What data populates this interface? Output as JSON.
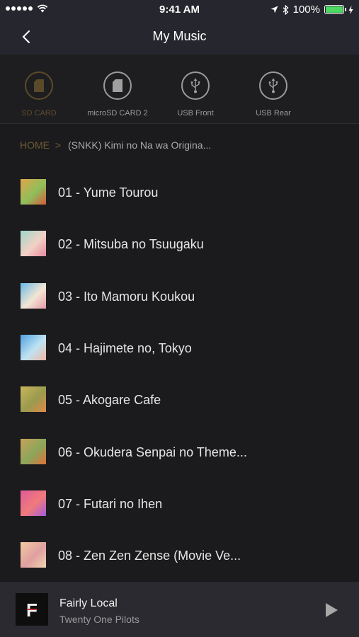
{
  "status_bar": {
    "time": "9:41 AM",
    "battery": "100%",
    "battery_level": 1.0
  },
  "nav": {
    "title": "My Music",
    "back_icon": "chevron-left-icon"
  },
  "sources": [
    {
      "label": "SD CARD",
      "icon": "sd-card-icon",
      "active": true
    },
    {
      "label": "microSD CARD 2",
      "icon": "sd-card-icon",
      "active": false
    },
    {
      "label": "USB Front",
      "icon": "usb-icon",
      "active": false
    },
    {
      "label": "USB Rear",
      "icon": "usb-icon",
      "active": false
    }
  ],
  "breadcrumb": {
    "home": "HOME",
    "separator": ">",
    "current": "(SNKK) Kimi no Na wa Origina..."
  },
  "tracks": [
    {
      "title": "01 - Yume Tourou",
      "art_colors": [
        "#e0a44a",
        "#8fbf5a",
        "#d65a3a"
      ]
    },
    {
      "title": "02 - Mitsuba no Tsuugaku",
      "art_colors": [
        "#9ed7c9",
        "#f2d1c5",
        "#e58aa0"
      ]
    },
    {
      "title": "03 - Ito Mamoru Koukou",
      "art_colors": [
        "#6ab8e6",
        "#f2e6d4",
        "#e79aa9"
      ]
    },
    {
      "title": "04 - Hajimete no, Tokyo",
      "art_colors": [
        "#4f9fe0",
        "#bfe3f2",
        "#f0b7a5"
      ]
    },
    {
      "title": "05 - Akogare Cafe",
      "art_colors": [
        "#c9b55a",
        "#9a9a4f",
        "#e08a4a"
      ]
    },
    {
      "title": "06 - Okudera Senpai no Theme...",
      "art_colors": [
        "#c9a25a",
        "#8aa65a",
        "#e0703a"
      ]
    },
    {
      "title": "07 - Futari no Ihen",
      "art_colors": [
        "#e05a9a",
        "#f07a7a",
        "#a55ae0"
      ]
    },
    {
      "title": "08 - Zen Zen Zense (Movie Ve...",
      "art_colors": [
        "#f0c9a0",
        "#e0a0a0",
        "#f0d5b0"
      ]
    }
  ],
  "now_playing": {
    "title": "Fairly Local",
    "artist": "Twenty One Pilots",
    "art_letter": "F",
    "play_icon": "play-icon"
  }
}
